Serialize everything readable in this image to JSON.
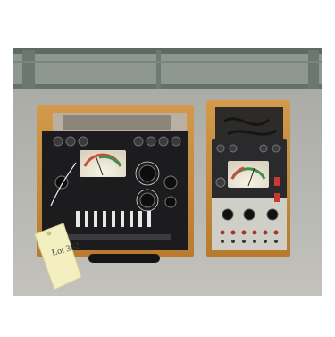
{
  "photo": {
    "subject": "photo",
    "tag_text": "Lot 362",
    "colors": {
      "floor": "#b9b7b1",
      "shelf": "#7f8a82",
      "wood": "#c78a3a",
      "panel": "#1c1c1e",
      "meter_face": "#eee8d8",
      "tag": "#f4efc0"
    }
  }
}
